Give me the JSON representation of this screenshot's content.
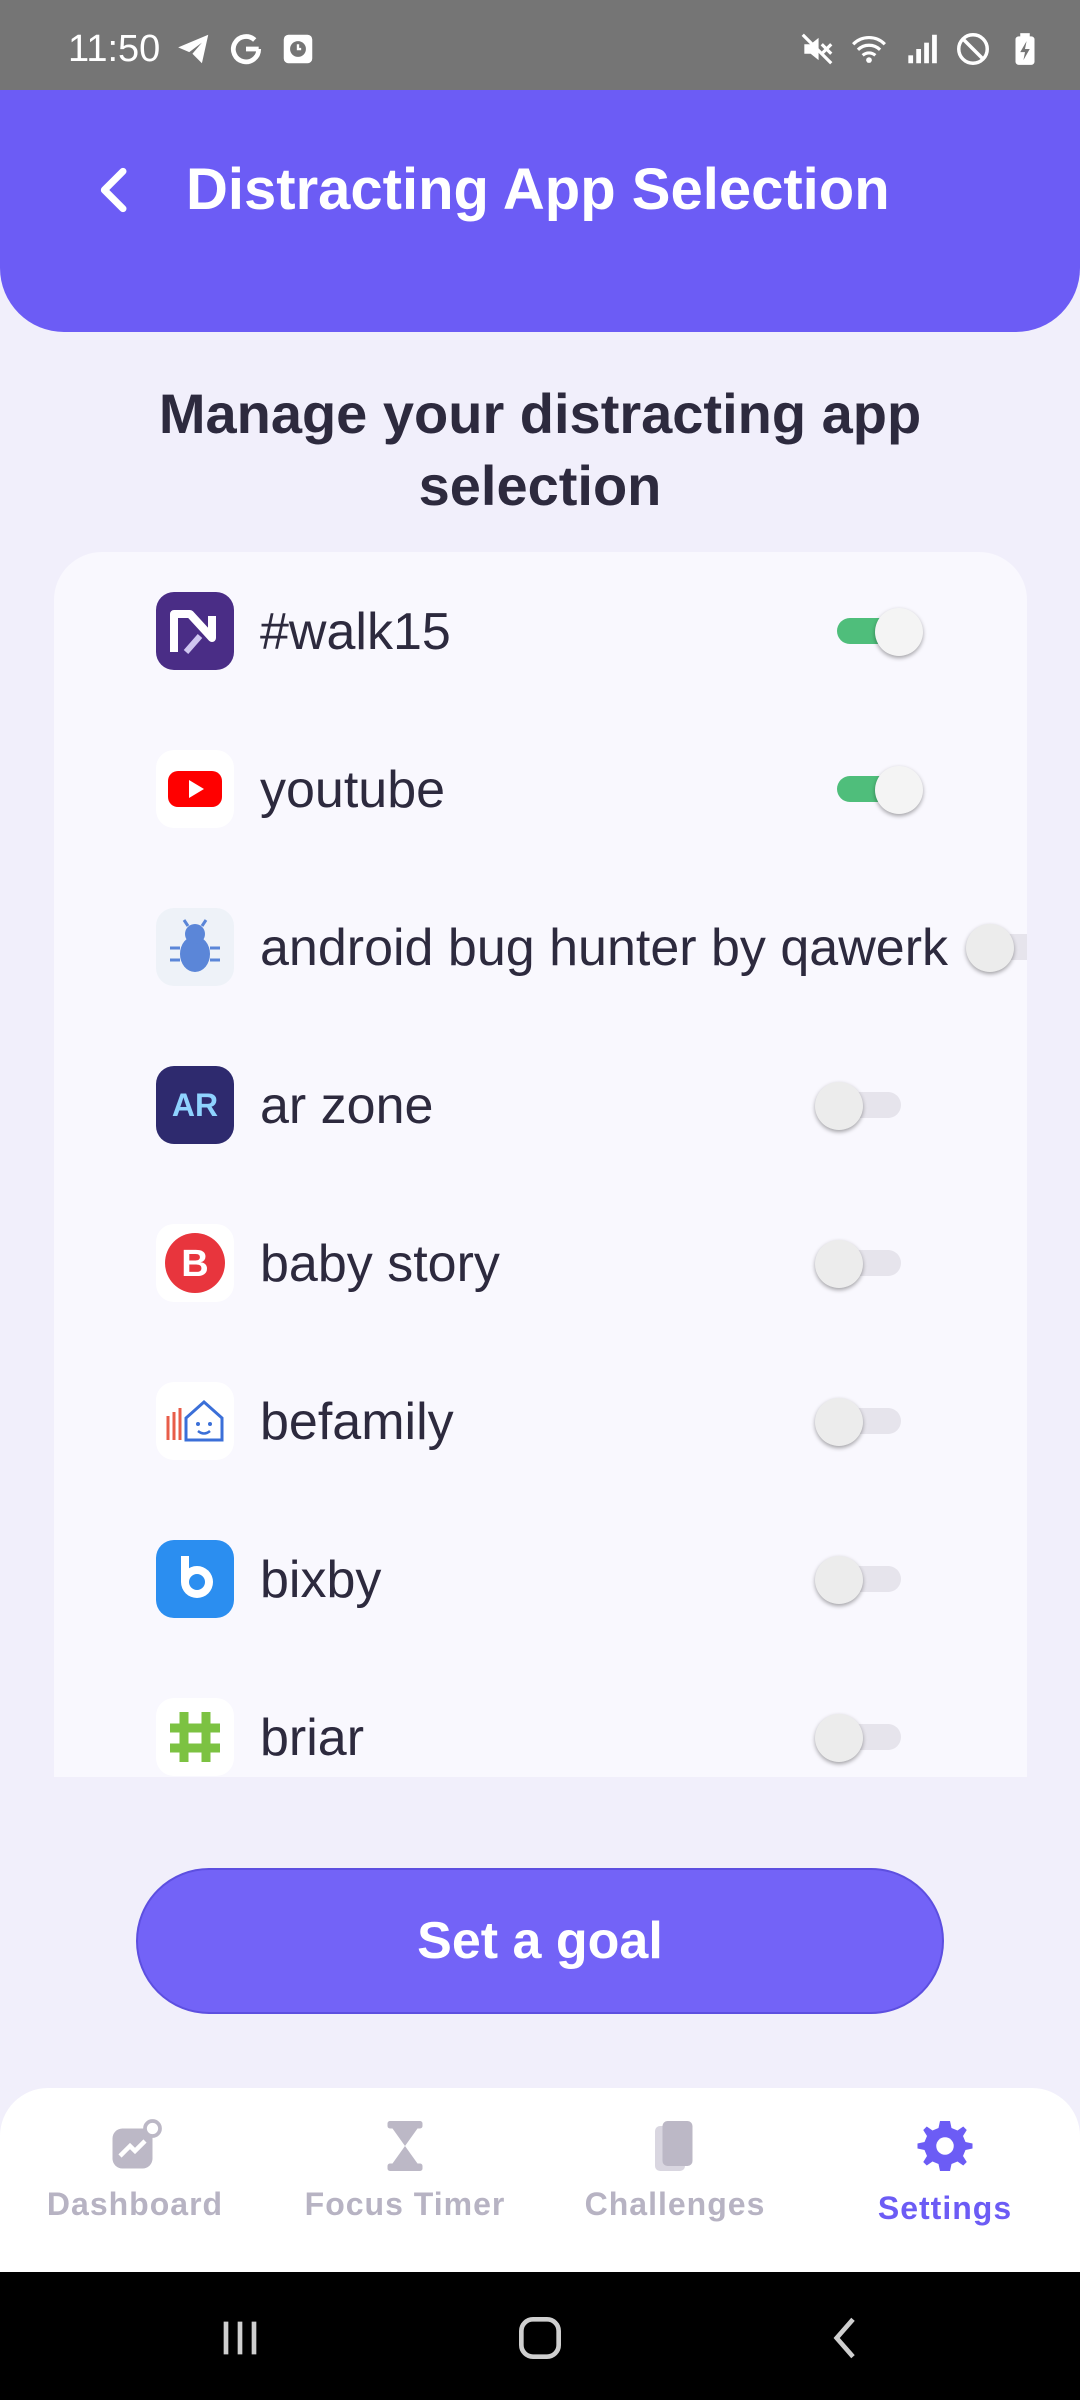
{
  "status_bar": {
    "time": "11:50",
    "left_icons": [
      "telegram-icon",
      "google-icon",
      "clock-app-icon"
    ],
    "right_icons": [
      "mute-icon",
      "wifi-icon",
      "signal-icon",
      "do-not-disturb-icon",
      "battery-charging-icon"
    ]
  },
  "header": {
    "title": "Distracting App Selection",
    "back_icon": "chevron-left-icon"
  },
  "subtitle": "Manage your distracting app selection",
  "apps": [
    {
      "name": "#walk15",
      "enabled": true,
      "icon": "walk15-icon"
    },
    {
      "name": "youtube",
      "enabled": true,
      "icon": "youtube-icon"
    },
    {
      "name": "android bug hunter by qawerk",
      "enabled": false,
      "icon": "bug-icon"
    },
    {
      "name": "ar zone",
      "enabled": false,
      "icon": "ar-zone-icon",
      "icon_text": "AR"
    },
    {
      "name": "baby story",
      "enabled": false,
      "icon": "baby-story-icon",
      "icon_text": "B"
    },
    {
      "name": "befamily",
      "enabled": false,
      "icon": "befamily-icon"
    },
    {
      "name": "bixby",
      "enabled": false,
      "icon": "bixby-icon"
    },
    {
      "name": "briar",
      "enabled": false,
      "icon": "briar-icon"
    }
  ],
  "cta_label": "Set a goal",
  "bottom_nav": [
    {
      "label": "Dashboard",
      "icon": "dashboard-icon",
      "active": false
    },
    {
      "label": "Focus Timer",
      "icon": "hourglass-icon",
      "active": false
    },
    {
      "label": "Challenges",
      "icon": "challenges-icon",
      "active": false
    },
    {
      "label": "Settings",
      "icon": "gear-icon",
      "active": true
    }
  ],
  "colors": {
    "primary": "#6c5cf5",
    "toggle_on": "#4fbe7b",
    "background": "#f1effb",
    "text": "#2d2a3e",
    "nav_inactive": "#b7b3c3"
  }
}
